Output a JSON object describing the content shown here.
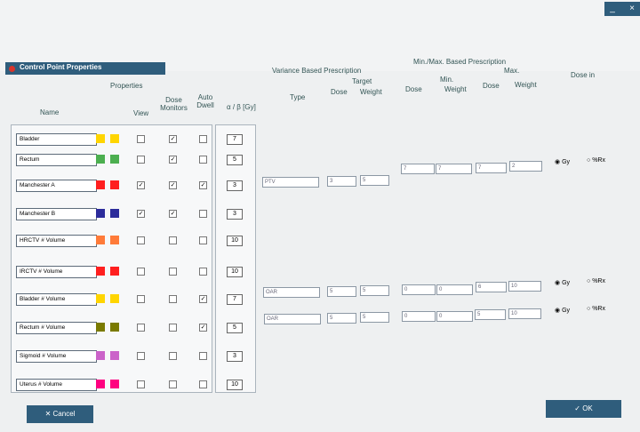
{
  "dialog": {
    "title": "Control Point Properties"
  },
  "headers": {
    "properties": "Properties",
    "name": "Name",
    "view": "View",
    "dose_monitors": "Dose Monitors",
    "auto_dwell": "Auto Dwell",
    "ab": "α / β [Gy]",
    "variance": "Variance Based Prescription",
    "type": "Type",
    "target": "Target",
    "dose": "Dose",
    "weight": "Weight",
    "minmax": "Min./Max. Based Prescription",
    "min": "Min.",
    "max": "Max.",
    "dose_in": "Dose in"
  },
  "rows": [
    {
      "name": "Bladder",
      "ab": "7",
      "c1": "#ffd500",
      "c2": "#ffd500",
      "view": false,
      "dose": true,
      "auto": false
    },
    {
      "name": "Rectum",
      "ab": "5",
      "c1": "#4caf50",
      "c2": "#4caf50",
      "view": false,
      "dose": true,
      "auto": false
    },
    {
      "name": "Manchester A",
      "ab": "3",
      "c1": "#ff1f1f",
      "c2": "#ff1f1f",
      "view": true,
      "dose": true,
      "auto": true
    },
    {
      "name": "Manchester B",
      "ab": "3",
      "c1": "#2c2c9b",
      "c2": "#2c2c9b",
      "view": true,
      "dose": true,
      "auto": false
    },
    {
      "name": "HRCTV # Volume",
      "ab": "10",
      "c1": "#ff7b39",
      "c2": "#ff7b39",
      "view": false,
      "dose": false,
      "auto": false
    },
    {
      "name": "IRCTV # Volume",
      "ab": "10",
      "c1": "#ff1f1f",
      "c2": "#ff1f1f",
      "view": false,
      "dose": false,
      "auto": false
    },
    {
      "name": "Bladder # Volume",
      "ab": "7",
      "c1": "#ffd500",
      "c2": "#ffd500",
      "view": false,
      "dose": false,
      "auto": true
    },
    {
      "name": "Rectum # Volume",
      "ab": "5",
      "c1": "#7a7a00",
      "c2": "#7a7a00",
      "view": false,
      "dose": false,
      "auto": true
    },
    {
      "name": "Sigmoid # Volume",
      "ab": "3",
      "c1": "#cb63c9",
      "c2": "#cb63c9",
      "view": false,
      "dose": false,
      "auto": false
    },
    {
      "name": "Uterus # Volume",
      "ab": "10",
      "c1": "#ff0080",
      "c2": "#ff0080",
      "view": false,
      "dose": false,
      "auto": false
    }
  ],
  "variance": [
    {
      "type": "PTV",
      "dose": "3",
      "weight": "5"
    },
    {
      "type": "OAR",
      "dose": "5",
      "weight": "5"
    },
    {
      "type": "OAR",
      "dose": "5",
      "weight": "5"
    }
  ],
  "minmax": [
    {
      "min_dose": "7",
      "min_weight": "7",
      "max_dose": "7",
      "max_weight": "2"
    },
    {
      "min_dose": "0",
      "min_weight": "0",
      "max_dose": "6",
      "max_weight": "10"
    },
    {
      "min_dose": "0",
      "min_weight": "0",
      "max_dose": "5",
      "max_weight": "10"
    }
  ],
  "dose_in": {
    "gy": "Gy",
    "rx": "%Rx"
  },
  "buttons": {
    "cancel": "Cancel",
    "ok": "OK"
  }
}
